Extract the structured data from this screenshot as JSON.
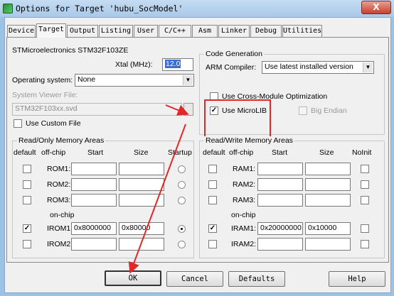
{
  "window": {
    "title": "Options for Target 'hubu_SocModel'",
    "close_glyph": "X"
  },
  "tabs": [
    {
      "label": "Device",
      "active": false
    },
    {
      "label": "Target",
      "active": true
    },
    {
      "label": "Output",
      "active": false
    },
    {
      "label": "Listing",
      "active": false
    },
    {
      "label": "User",
      "active": false
    },
    {
      "label": "C/C++",
      "active": false
    },
    {
      "label": "Asm",
      "active": false
    },
    {
      "label": "Linker",
      "active": false
    },
    {
      "label": "Debug",
      "active": false
    },
    {
      "label": "Utilities",
      "active": false
    }
  ],
  "target": {
    "device_name": "STMicroelectronics STM32F103ZE",
    "xtal_label": "Xtal (MHz):",
    "xtal_value": "12.0",
    "os_label": "Operating system:",
    "os_value": "None",
    "svd_label": "System Viewer File:",
    "svd_value": "STM32F103xx.svd",
    "custom_file_label": "Use Custom File",
    "custom_file_checked": false
  },
  "code_gen": {
    "title": "Code Generation",
    "compiler_label": "ARM Compiler:",
    "compiler_value": "Use latest installed version",
    "cross_module_label": "Use Cross-Module Optimization",
    "cross_module_checked": false,
    "microlib_label": "Use MicroLIB",
    "microlib_checked": true,
    "big_endian_label": "Big Endian",
    "big_endian_checked": false
  },
  "rom": {
    "title": "Read/Only Memory Areas",
    "headers": {
      "default": "default",
      "offchip": "off-chip",
      "start": "Start",
      "size": "Size",
      "startup": "Startup"
    },
    "onchip_label": "on-chip",
    "rows": [
      {
        "name": "ROM1:",
        "default": false,
        "start": "",
        "size": "",
        "startup": false
      },
      {
        "name": "ROM2:",
        "default": false,
        "start": "",
        "size": "",
        "startup": false
      },
      {
        "name": "ROM3:",
        "default": false,
        "start": "",
        "size": "",
        "startup": false
      },
      {
        "name": "IROM1:",
        "default": true,
        "start": "0x8000000",
        "size": "0x80000",
        "startup": true
      },
      {
        "name": "IROM2:",
        "default": false,
        "start": "",
        "size": "",
        "startup": false
      }
    ]
  },
  "ram": {
    "title": "Read/Write Memory Areas",
    "headers": {
      "default": "default",
      "offchip": "off-chip",
      "start": "Start",
      "size": "Size",
      "noinit": "NoInit"
    },
    "onchip_label": "on-chip",
    "rows": [
      {
        "name": "RAM1:",
        "default": false,
        "start": "",
        "size": "",
        "noinit": false
      },
      {
        "name": "RAM2:",
        "default": false,
        "start": "",
        "size": "",
        "noinit": false
      },
      {
        "name": "RAM3:",
        "default": false,
        "start": "",
        "size": "",
        "noinit": false
      },
      {
        "name": "IRAM1:",
        "default": true,
        "start": "0x20000000",
        "size": "0x10000",
        "noinit": false
      },
      {
        "name": "IRAM2:",
        "default": false,
        "start": "",
        "size": "",
        "noinit": false
      }
    ]
  },
  "buttons": {
    "ok": "OK",
    "cancel": "Cancel",
    "defaults": "Defaults",
    "help": "Help"
  },
  "glyphs": {
    "check": "✓",
    "combo_arrow": "▼"
  },
  "colors": {
    "annotation": "#e0282a",
    "selection": "#3a6fd6"
  }
}
